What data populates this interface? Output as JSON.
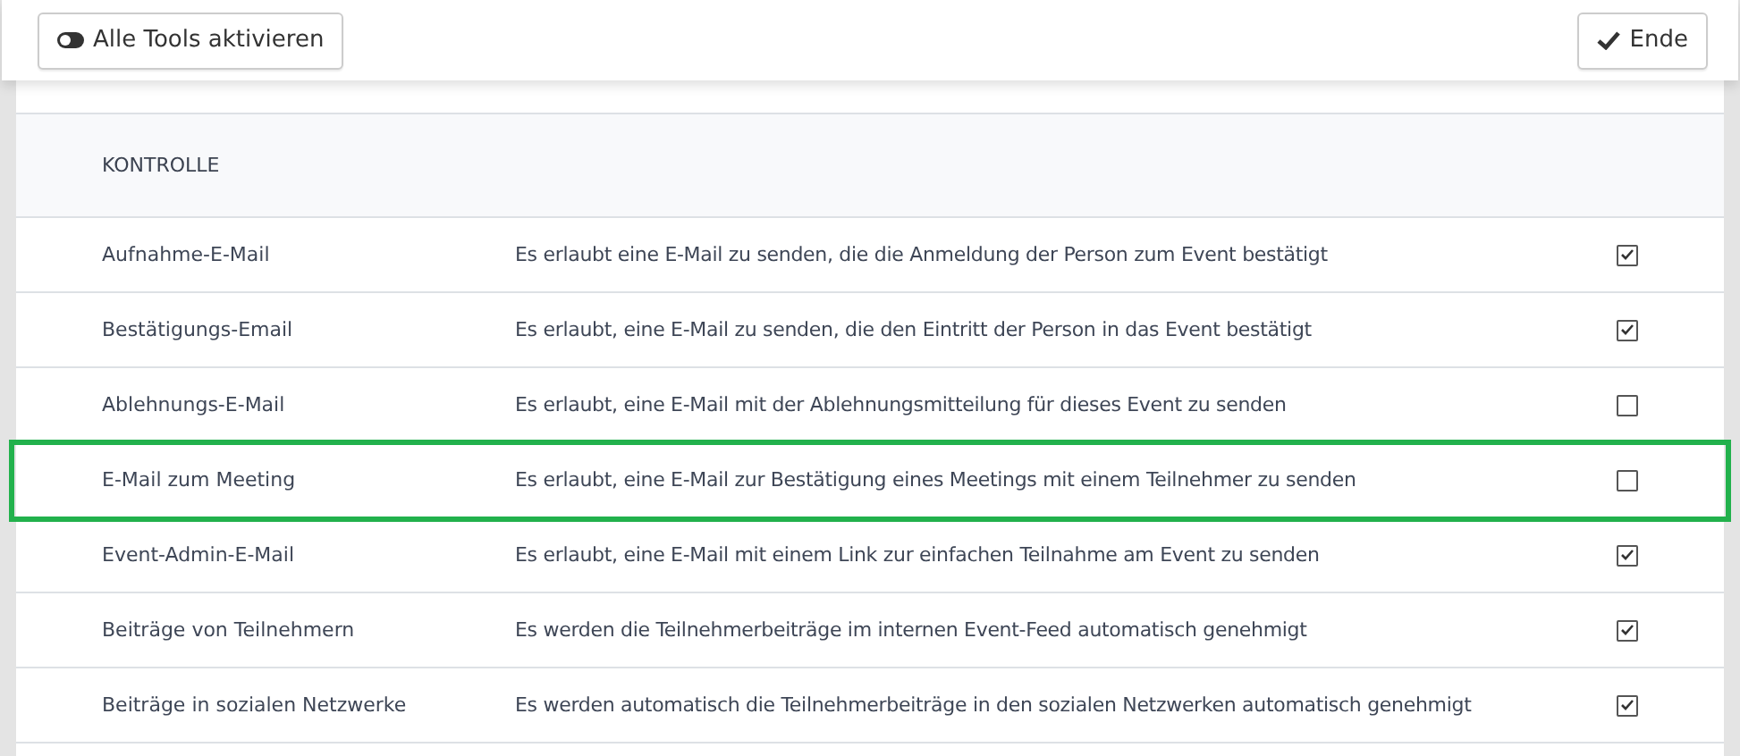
{
  "toolbar": {
    "toggle_button": "Alle Tools aktivieren",
    "end_button": "Ende"
  },
  "section": {
    "title": "KONTROLLE"
  },
  "rows": [
    {
      "name": "Aufnahme-E-Mail",
      "description": "Es erlaubt eine E-Mail zu senden, die die Anmeldung der Person zum Event bestätigt",
      "checked": true,
      "highlighted": false
    },
    {
      "name": "Bestätigungs-Email",
      "description": "Es erlaubt, eine E-Mail zu senden, die den Eintritt der Person in das Event bestätigt",
      "checked": true,
      "highlighted": false
    },
    {
      "name": "Ablehnungs-E-Mail",
      "description": "Es erlaubt, eine E-Mail mit der Ablehnungsmitteilung für dieses Event zu senden",
      "checked": false,
      "highlighted": false
    },
    {
      "name": "E-Mail zum Meeting",
      "description": "Es erlaubt, eine E-Mail zur Bestätigung eines Meetings mit einem Teilnehmer zu senden",
      "checked": false,
      "highlighted": true
    },
    {
      "name": "Event-Admin-E-Mail",
      "description": "Es erlaubt, eine E-Mail mit einem Link zur einfachen Teilnahme am Event zu senden",
      "checked": true,
      "highlighted": false
    },
    {
      "name": "Beiträge von Teilnehmern",
      "description": "Es werden die Teilnehmerbeiträge im internen Event-Feed automatisch genehmigt",
      "checked": true,
      "highlighted": false
    },
    {
      "name": "Beiträge in sozialen Netzwerke",
      "description": "Es werden automatisch die Teilnehmerbeiträge in den sozialen Netzwerken automatisch genehmigt",
      "checked": true,
      "highlighted": false
    }
  ]
}
